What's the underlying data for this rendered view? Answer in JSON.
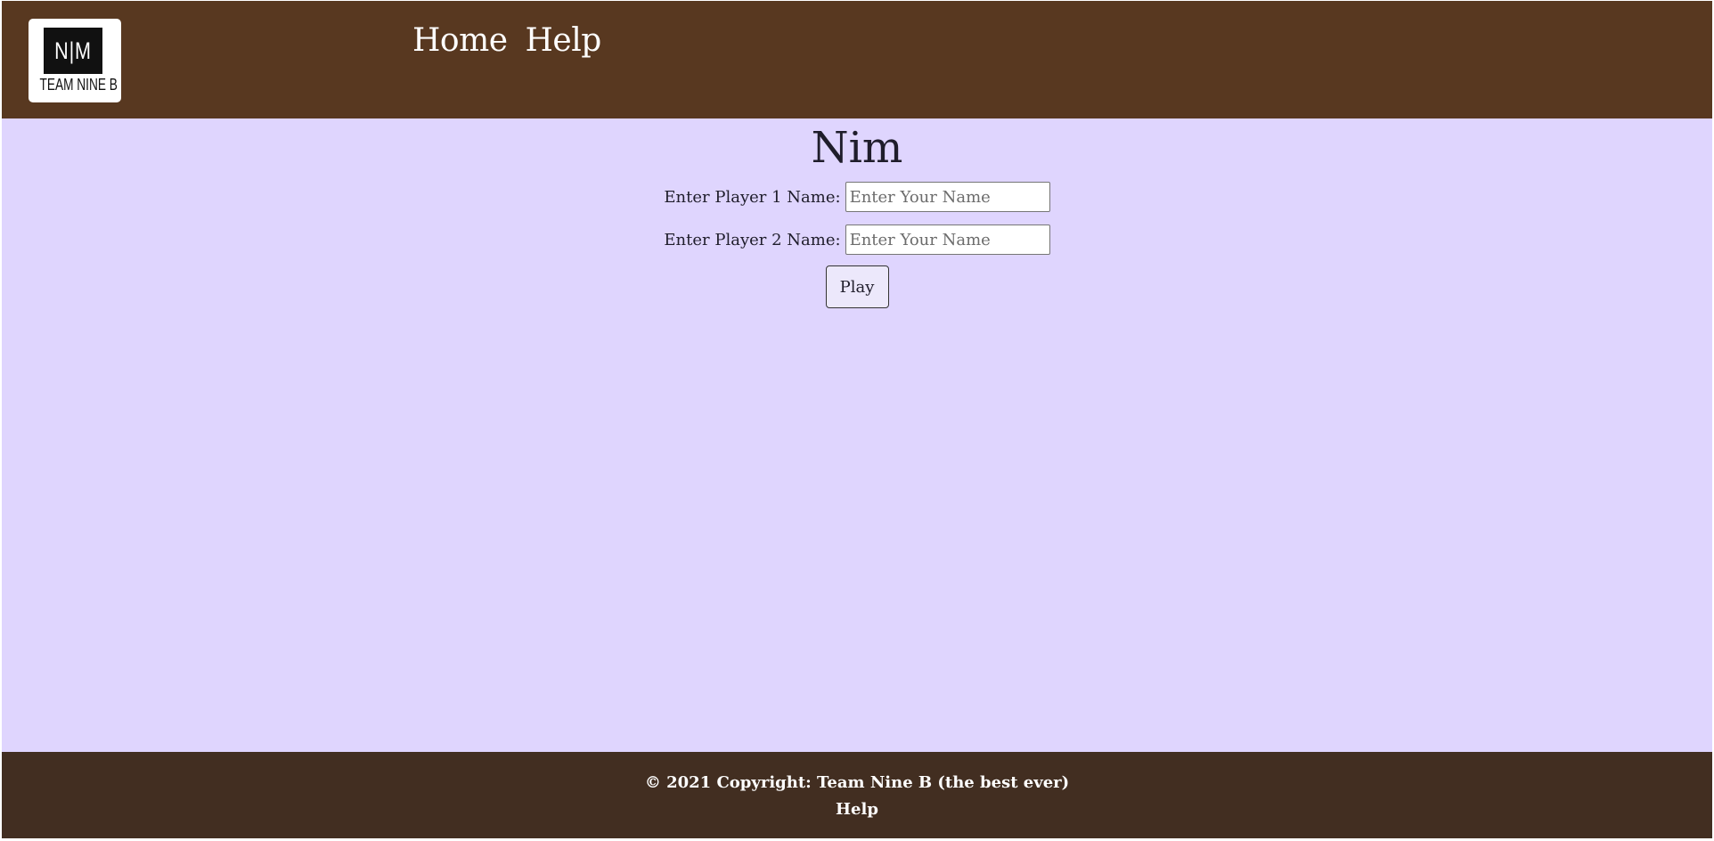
{
  "header": {
    "logo": {
      "mark": "N|M",
      "team": "TEAM NINE B"
    },
    "nav": [
      {
        "label": "Home"
      },
      {
        "label": "Help"
      }
    ]
  },
  "main": {
    "title": "Nim",
    "player1": {
      "label": "Enter Player 1 Name:",
      "placeholder": "Enter Your Name",
      "value": ""
    },
    "player2": {
      "label": "Enter Player 2 Name:",
      "placeholder": "Enter Your Name",
      "value": ""
    },
    "play_label": "Play"
  },
  "footer": {
    "copyright": "© 2021 Copyright: Team Nine B (the best ever)",
    "help_label": "Help"
  },
  "colors": {
    "header_bg": "#583820",
    "main_bg": "#dfd5fe",
    "footer_bg": "#422e21",
    "text": "#1f1d2b"
  }
}
